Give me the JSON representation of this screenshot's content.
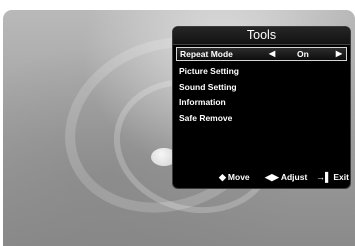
{
  "menu": {
    "title": "Tools",
    "items": [
      {
        "label": "Repeat Mode",
        "value": "On",
        "selected": true
      },
      {
        "label": "Picture Setting"
      },
      {
        "label": "Sound Setting"
      },
      {
        "label": "Information"
      },
      {
        "label": "Safe Remove"
      }
    ]
  },
  "hints": {
    "move_label": "Move",
    "adjust_label": "Adjust",
    "exit_label": "Exit",
    "move_icon": "updown-arrows-icon",
    "adjust_icon": "leftright-arrows-icon",
    "exit_icon": "exit-icon"
  },
  "colors": {
    "menu_background": "#000000",
    "text": "#ffffff",
    "selection_border": "#d6d6d6"
  }
}
